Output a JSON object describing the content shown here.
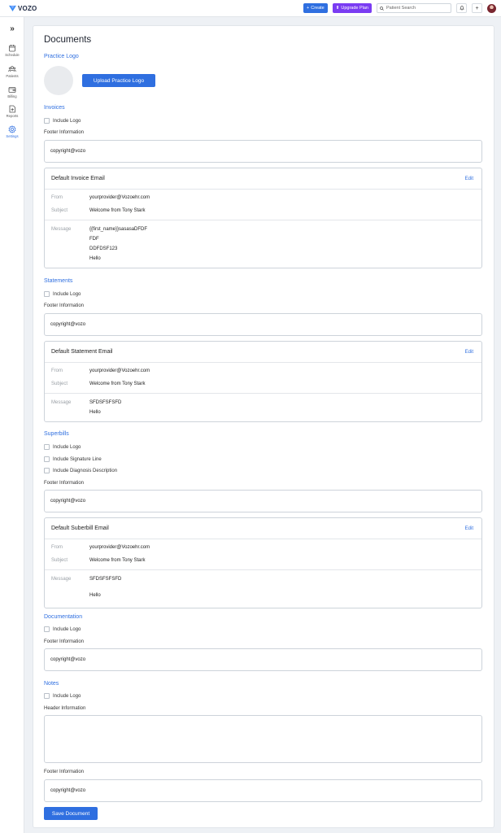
{
  "app": {
    "brand": "VOZO"
  },
  "topbar": {
    "create_label": "Create",
    "upgrade_label": "Upgrade Plan",
    "search_placeholder": "Patient Search"
  },
  "sidebar": {
    "items": [
      {
        "label": "Schedule",
        "icon": "calendar-icon"
      },
      {
        "label": "Patients",
        "icon": "users-icon"
      },
      {
        "label": "Billing",
        "icon": "wallet-icon"
      },
      {
        "label": "Reports",
        "icon": "report-icon"
      },
      {
        "label": "Settings",
        "icon": "gear-icon",
        "active": true
      }
    ]
  },
  "page": {
    "title": "Documents",
    "practice_logo": {
      "section_title": "Practice Logo",
      "upload_button": "Upload Practice Logo"
    },
    "invoices": {
      "section_title": "Invoices",
      "include_logo": "Include Logo",
      "footer_label": "Footer Information",
      "footer_value": "copyright@vozo",
      "email": {
        "title": "Default Invoice Email",
        "edit": "Edit",
        "from_label": "From",
        "from": "yourprovider@Vozoehr.com",
        "subject_label": "Subject",
        "subject": "Welcome from Tony Stark",
        "message_label": "Message",
        "message_lines": [
          "{{first_name}}sasasaDFDF",
          "FDF",
          "DDFDSF123",
          "Hello"
        ]
      }
    },
    "statements": {
      "section_title": "Statements",
      "include_logo": "Include Logo",
      "footer_label": "Footer Information",
      "footer_value": "copyright@vozo",
      "email": {
        "title": "Default Statement Email",
        "edit": "Edit",
        "from_label": "From",
        "from": "yourprovider@Vozoehr.com",
        "subject_label": "Subject",
        "subject": "Welcome from Tony Stark",
        "message_label": "Message",
        "message_lines": [
          "SFDSFSFSFD",
          "Hello"
        ]
      }
    },
    "superbills": {
      "section_title": "Superbills",
      "include_logo": "Include Logo",
      "include_signature": "Include Signature Line",
      "include_diagnosis": "Include Diagnosis Description",
      "footer_label": "Footer Information",
      "footer_value": "copyright@vozo",
      "email": {
        "title": "Default Suberbill Email",
        "edit": "Edit",
        "from_label": "From",
        "from": "yourprovider@Vozoehr.com",
        "subject_label": "Subject",
        "subject": "Welcome from Tony Stark",
        "message_label": "Message",
        "message_lines": [
          "SFDSFSFSFD",
          "Hello"
        ]
      }
    },
    "documentation": {
      "section_title": "Documentation",
      "include_logo": "Include Logo",
      "footer_label": "Footer Information",
      "footer_value": "copyright@vozo"
    },
    "notes": {
      "section_title": "Notes",
      "include_logo": "Include Logo",
      "header_label": "Header Information",
      "header_value": "",
      "footer_label": "Footer Information",
      "footer_value": "copyright@vozo"
    },
    "save_button": "Save Document"
  }
}
